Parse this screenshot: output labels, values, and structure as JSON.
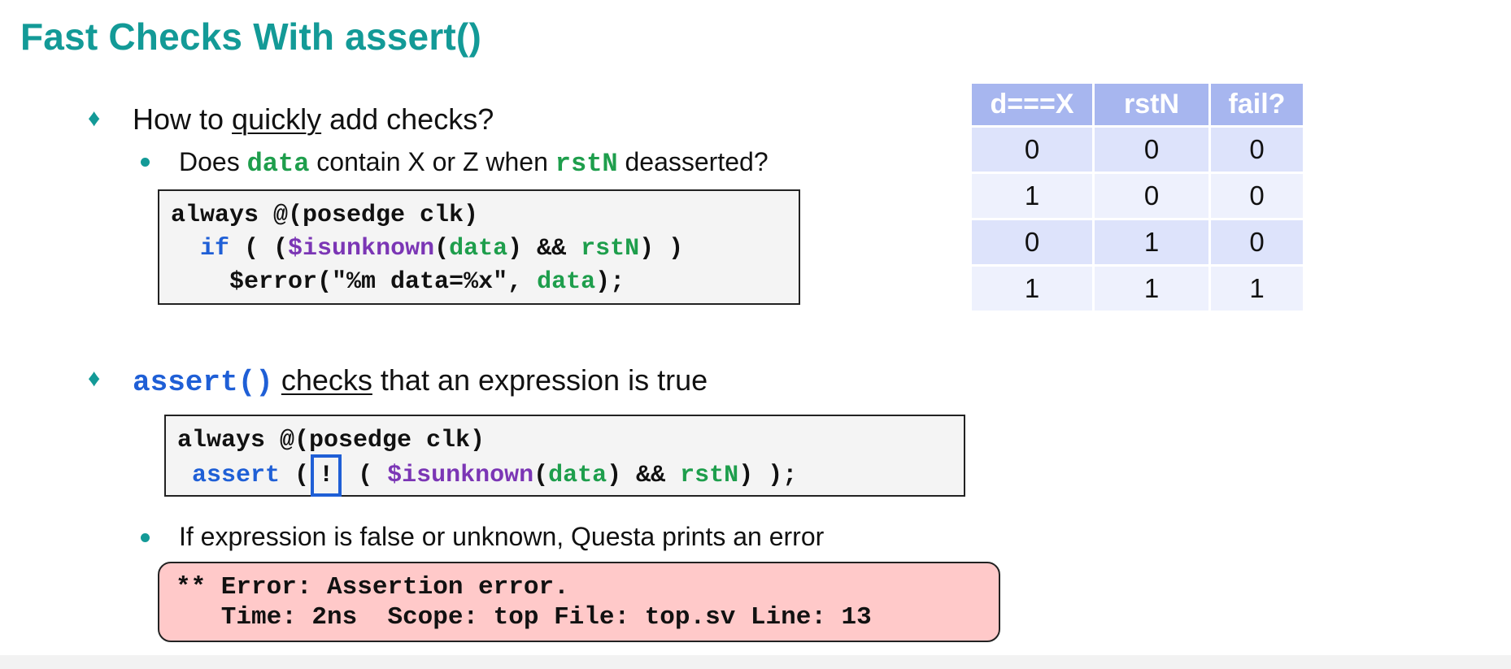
{
  "slide": {
    "title": "Fast Checks With assert()"
  },
  "bullet1": {
    "prefix": "How to ",
    "underlined": "quickly",
    "suffix": " add checks?",
    "sub": {
      "t1": "Does ",
      "c1": "data",
      "t2": " contain X or Z when ",
      "c2": "rstN",
      "t3": " deasserted?"
    }
  },
  "code1": {
    "line1": "always @(posedge clk)",
    "line2": {
      "indent": "  ",
      "kw_if": "if",
      "p1": " ( (",
      "fn": "$isunknown",
      "p2": "(",
      "var_data": "data",
      "p3": ") && ",
      "var_rstn": "rstN",
      "p4": ") )"
    },
    "line3": {
      "indent": "    ",
      "pre": "$error(\"%m data=%x\", ",
      "var_data": "data",
      "post": ");"
    }
  },
  "truth_table": {
    "headers": [
      "d===X",
      "rstN",
      "fail?"
    ],
    "rows": [
      [
        "0",
        "0",
        "0"
      ],
      [
        "1",
        "0",
        "0"
      ],
      [
        "0",
        "1",
        "0"
      ],
      [
        "1",
        "1",
        "1"
      ]
    ],
    "colors": {
      "header_bg": "#a7b6ef",
      "row_a": "#dde3fb",
      "row_b": "#eef1fd"
    }
  },
  "bullet2": {
    "code": "assert()",
    "underlined": "checks",
    "suffix": " that an expression is true"
  },
  "code2": {
    "line1": "always @(posedge clk)",
    "line2": {
      "indent": " ",
      "kw_assert": "assert",
      "p1": " (",
      "bang": "!",
      "p2": " ( ",
      "fn": "$isunknown",
      "p3": "(",
      "var_data": "data",
      "p4": ") && ",
      "var_rstn": "rstN",
      "p5": ") );"
    }
  },
  "bullet3": {
    "text": "If expression is false or unknown, Questa prints an error"
  },
  "error_box": {
    "line1": "** Error: Assertion error.",
    "line2": "   Time: 2ns  Scope: top File: top.sv Line: 13"
  },
  "colors": {
    "title": "#139a97",
    "code_green": "#1e9e4c",
    "code_blue": "#1f5fd6",
    "code_purple": "#7b36b5",
    "error_bg": "#ffc9c9"
  },
  "icons": [
    "diamond-bullet-icon",
    "dot-bullet-icon"
  ]
}
